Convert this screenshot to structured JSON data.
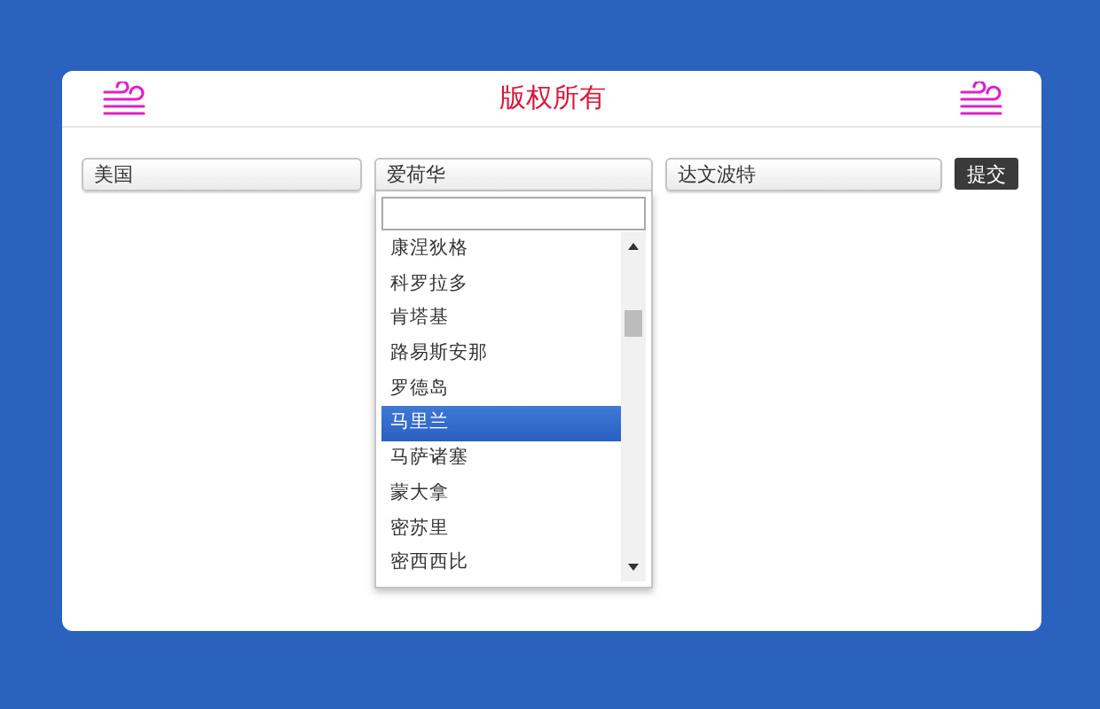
{
  "header": {
    "title": "版权所有"
  },
  "selects": [
    {
      "value": "美国",
      "expanded": false
    },
    {
      "value": "爱荷华",
      "expanded": true
    },
    {
      "value": "达文波特",
      "expanded": false
    }
  ],
  "dropdown": {
    "options": [
      {
        "label": "康涅狄格",
        "selected": false
      },
      {
        "label": "科罗拉多",
        "selected": false
      },
      {
        "label": "肯塔基",
        "selected": false
      },
      {
        "label": "路易斯安那",
        "selected": false
      },
      {
        "label": "罗德岛",
        "selected": false
      },
      {
        "label": "马里兰",
        "selected": true
      },
      {
        "label": "马萨诸塞",
        "selected": false
      },
      {
        "label": "蒙大拿",
        "selected": false
      },
      {
        "label": "密苏里",
        "selected": false
      },
      {
        "label": "密西西比",
        "selected": false
      }
    ]
  },
  "submit": {
    "label": "提交"
  }
}
